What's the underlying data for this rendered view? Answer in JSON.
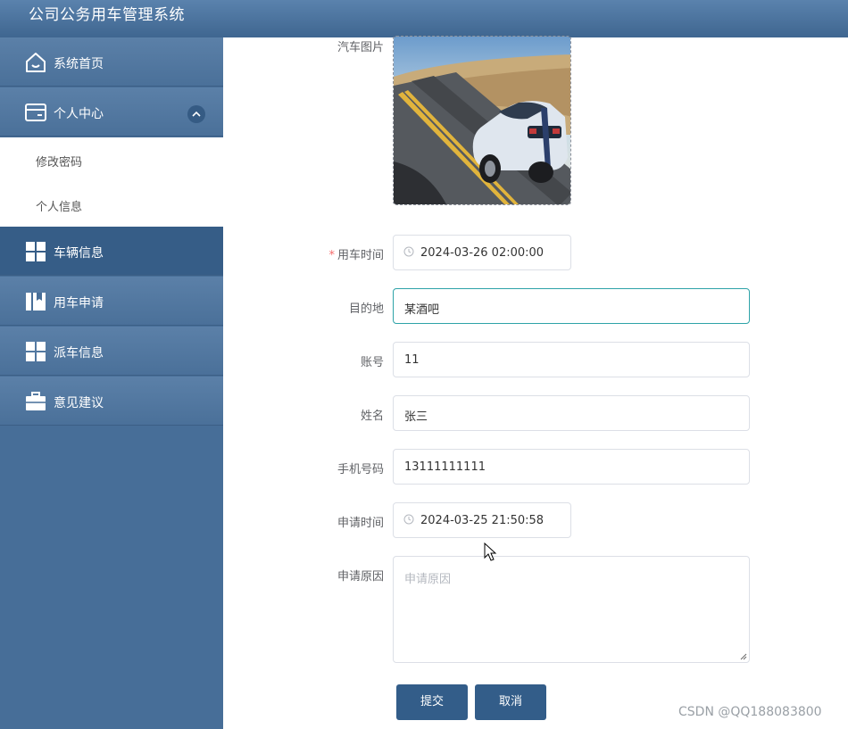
{
  "app": {
    "title": "公司公务用车管理系统"
  },
  "sidebar": {
    "items": [
      {
        "label": "系统首页",
        "icon": "home-icon"
      },
      {
        "label": "个人中心",
        "icon": "card-icon",
        "expanded": true
      },
      {
        "label": "车辆信息",
        "icon": "grid-icon",
        "active": true
      },
      {
        "label": "用车申请",
        "icon": "book-icon"
      },
      {
        "label": "派车信息",
        "icon": "grid-icon"
      },
      {
        "label": "意见建议",
        "icon": "briefcase-icon"
      }
    ],
    "submenu": [
      {
        "label": "修改密码"
      },
      {
        "label": "个人信息"
      }
    ]
  },
  "form": {
    "car_image": {
      "label": "汽车图片"
    },
    "use_time": {
      "label": "用车时间",
      "required": true,
      "value": "2024-03-26 02:00:00"
    },
    "destination": {
      "label": "目的地",
      "value": "某酒吧"
    },
    "account": {
      "label": "账号",
      "value": "11"
    },
    "name": {
      "label": "姓名",
      "value": "张三"
    },
    "phone": {
      "label": "手机号码",
      "value": "13111111111"
    },
    "apply_time": {
      "label": "申请时间",
      "value": "2024-03-25 21:50:58"
    },
    "reason": {
      "label": "申请原因",
      "placeholder": "申请原因",
      "value": ""
    }
  },
  "buttons": {
    "submit": "提交",
    "cancel": "取消"
  },
  "watermark": "CSDN @QQ188083800",
  "colors": {
    "sidebar": "#476e98",
    "active": "#365d87",
    "button": "#335d89",
    "focus": "#2ea3a8",
    "required": "#f56c6c"
  }
}
